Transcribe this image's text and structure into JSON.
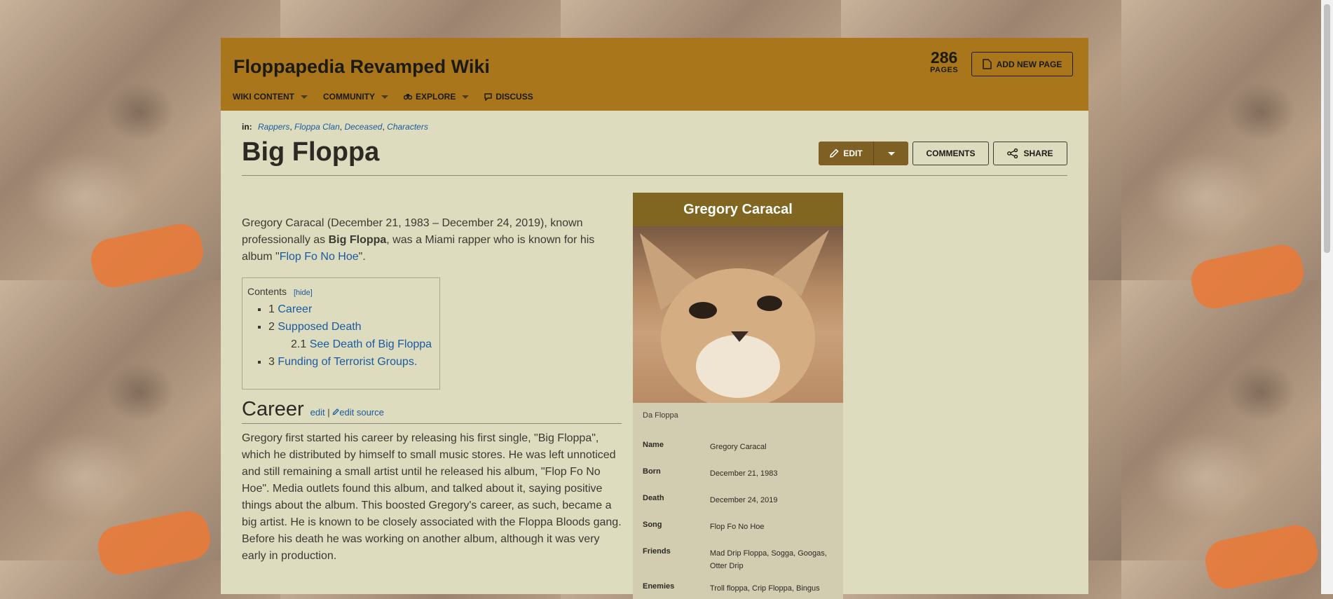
{
  "header": {
    "wiki_title": "Floppapedia Revamped Wiki",
    "pages_count": "286",
    "pages_label": "PAGES",
    "add_page_label": "ADD NEW PAGE",
    "nav": [
      {
        "label": "WIKI CONTENT",
        "has_caret": true
      },
      {
        "label": "COMMUNITY",
        "has_caret": true
      },
      {
        "label": "EXPLORE",
        "has_caret": true
      },
      {
        "label": "DISCUSS",
        "has_caret": false
      }
    ]
  },
  "categories": {
    "prefix": "in:",
    "items": [
      "Rappers",
      "Floppa Clan",
      "Deceased",
      "Characters"
    ]
  },
  "page": {
    "title": "Big Floppa",
    "edit_label": "EDIT",
    "comments_label": "COMMENTS",
    "share_label": "SHARE"
  },
  "intro": {
    "part1": "Gregory Caracal (December 21, 1983 – December 24, 2019), known professionally as ",
    "bold": "Big Floppa",
    "part2": ", was a Miami rapper who is known for his album \"",
    "link": "Flop Fo No Hoe",
    "part3": "\"."
  },
  "toc": {
    "title": "Contents",
    "hide_label": "[hide]",
    "items": [
      {
        "num": "1",
        "label": "Career"
      },
      {
        "num": "2",
        "label": "Supposed Death"
      },
      {
        "num": "2.1",
        "label": "See Death of Big Floppa"
      },
      {
        "num": "3",
        "label": "Funding of Terrorist Groups."
      }
    ]
  },
  "section": {
    "heading": "Career",
    "edit_label": "edit",
    "separator": "|",
    "edit_source_label": "edit source",
    "text": "Gregory first started his career by releasing his first single, \"Big Floppa\", which he distributed by himself to small music stores. He was left unnoticed and still remaining a small artist until he released his album, \"Flop Fo No Hoe\". Media outlets found this album, and talked about it, saying positive things about the album. This boosted Gregory's career, as such, became a big artist. He is known to be closely associated with the Floppa Bloods gang. Before his death he was working on another album, although it was very early in production."
  },
  "infobox": {
    "title": "Gregory Caracal",
    "caption": "Da Floppa",
    "rows": [
      {
        "key": "Name",
        "value": "Gregory Caracal"
      },
      {
        "key": "Born",
        "value": "December 21, 1983"
      },
      {
        "key": "Death",
        "value": "December 24, 2019"
      },
      {
        "key": "Song",
        "value": "Flop Fo No Hoe"
      },
      {
        "key": "Friends",
        "value": "Mad Drip Floppa, Sogga, Googas, Otter Drip"
      },
      {
        "key": "Enemies",
        "value": "Troll floppa, Crip Floppa, Bingus"
      }
    ]
  },
  "colors": {
    "header_bg": "#a9761c",
    "page_bg": "#dedcbf",
    "link": "#1a5aa0",
    "edit_button": "#7e6024",
    "infobox_title_bg": "#806621"
  }
}
